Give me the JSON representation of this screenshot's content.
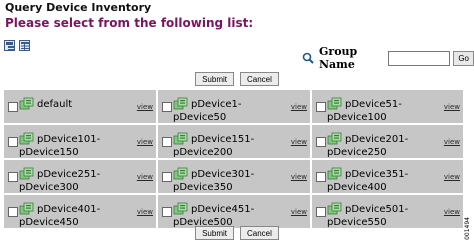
{
  "header": {
    "title": "Query Device Inventory",
    "subtitle": "Please select from the following list:"
  },
  "toolbar": {
    "view_icons": [
      "tree-view-icon",
      "table-view-icon"
    ]
  },
  "search": {
    "label": "Group Name",
    "value": "",
    "go_label": "Go",
    "icon": "search-icon"
  },
  "buttons": {
    "submit": "Submit",
    "cancel": "Cancel"
  },
  "groups": [
    {
      "name": "default",
      "view": "view"
    },
    {
      "name": "pDevice1-pDevice50",
      "view": "view"
    },
    {
      "name": "pDevice51-pDevice100",
      "view": "view"
    },
    {
      "name": "pDevice101-pDevice150",
      "view": "view"
    },
    {
      "name": "pDevice151-pDevice200",
      "view": "view"
    },
    {
      "name": "pDevice201-pDevice250",
      "view": "view"
    },
    {
      "name": "pDevice251-pDevice300",
      "view": "view"
    },
    {
      "name": "pDevice301-pDevice350",
      "view": "view"
    },
    {
      "name": "pDevice351-pDevice400",
      "view": "view"
    },
    {
      "name": "pDevice401-pDevice450",
      "view": "view"
    },
    {
      "name": "pDevice451-pDevice500",
      "view": "view"
    },
    {
      "name": "pDevice501-pDevice550",
      "view": "view"
    }
  ],
  "figure_id": "001494",
  "colors": {
    "subtitle": "#7a1660",
    "cell_bg": "#c6c6c6",
    "device_icon": "#4a9a4a"
  }
}
